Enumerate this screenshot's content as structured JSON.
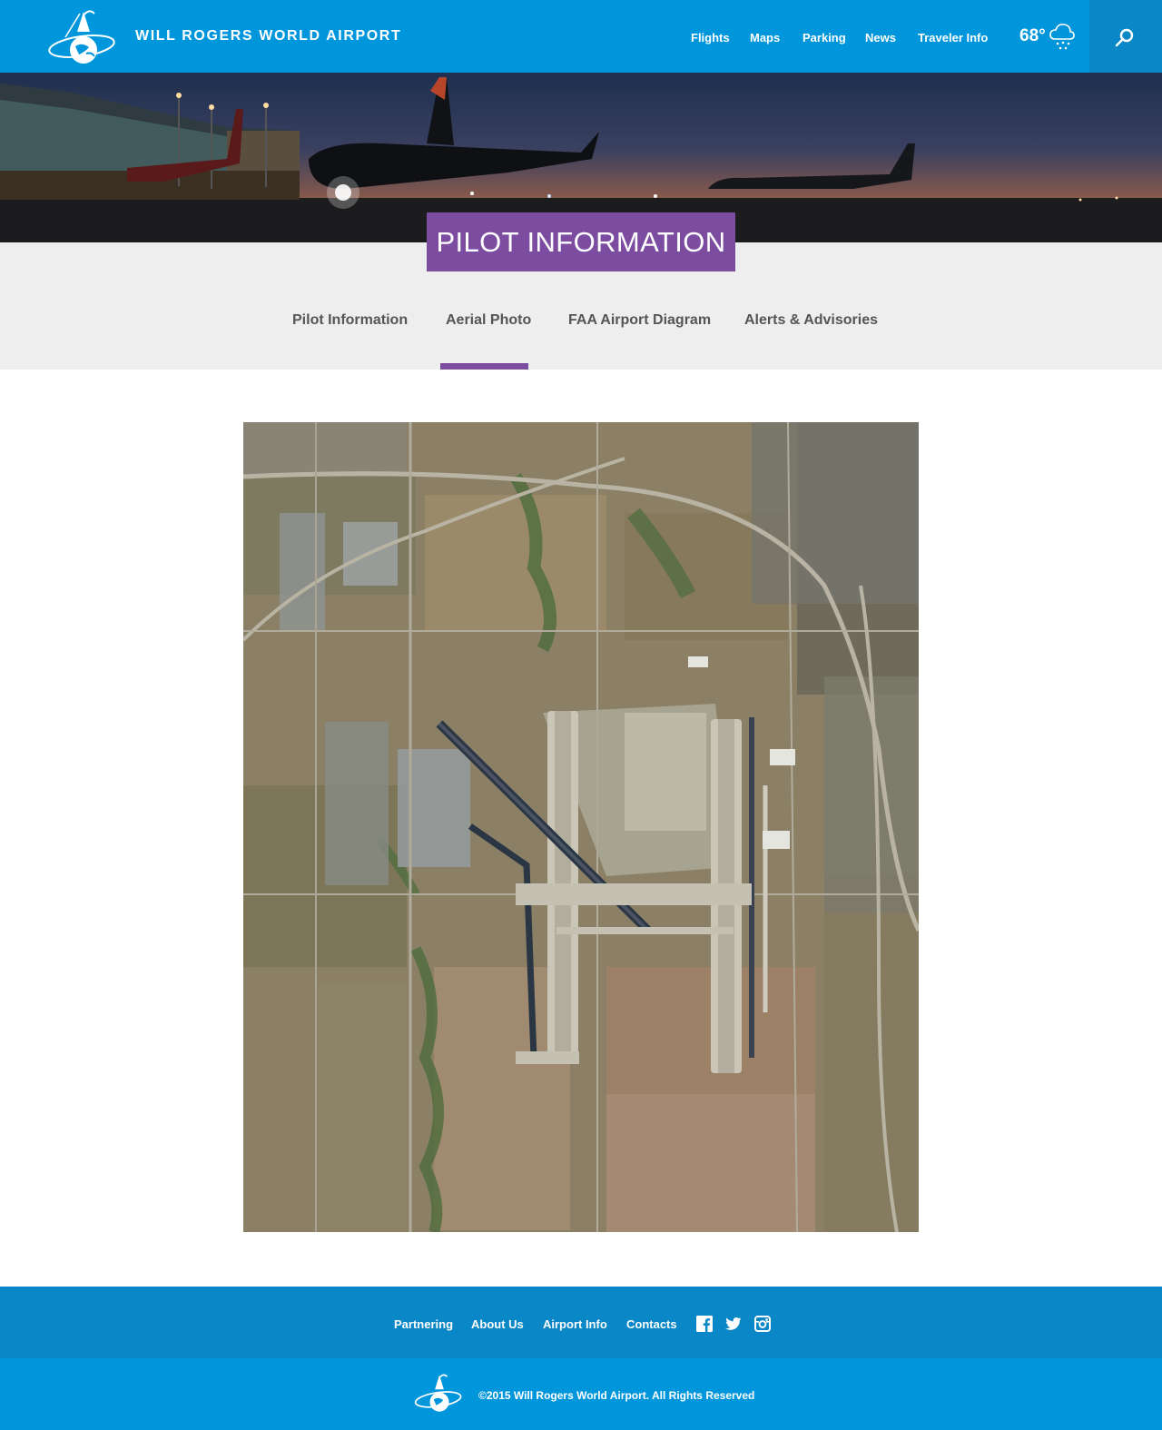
{
  "header": {
    "site_title": "WILL ROGERS WORLD AIRPORT",
    "nav": [
      "Flights",
      "Maps",
      "Parking",
      "News",
      "Traveler Info"
    ],
    "weather": {
      "temperature": "68°",
      "icon": "cloud-snow-icon"
    },
    "search_icon": "search-icon"
  },
  "page": {
    "title": "PILOT INFORMATION",
    "tabs": [
      "Pilot Information",
      "Aerial Photo",
      "FAA Airport Diagram",
      "Alerts & Advisories"
    ],
    "active_tab": "Aerial Photo"
  },
  "footer": {
    "links": [
      "Partnering",
      "About Us",
      "Airport Info",
      "Contacts"
    ],
    "social": [
      "facebook-icon",
      "twitter-icon",
      "instagram-icon"
    ],
    "copyright": "©2015 Will Rogers World Airport. All Rights Reserved"
  },
  "colors": {
    "header_blue": "#0096dc",
    "footer_dark_blue": "#0a87c6",
    "accent_purple": "#7b4c9f",
    "band_grey": "#eeeeee"
  }
}
